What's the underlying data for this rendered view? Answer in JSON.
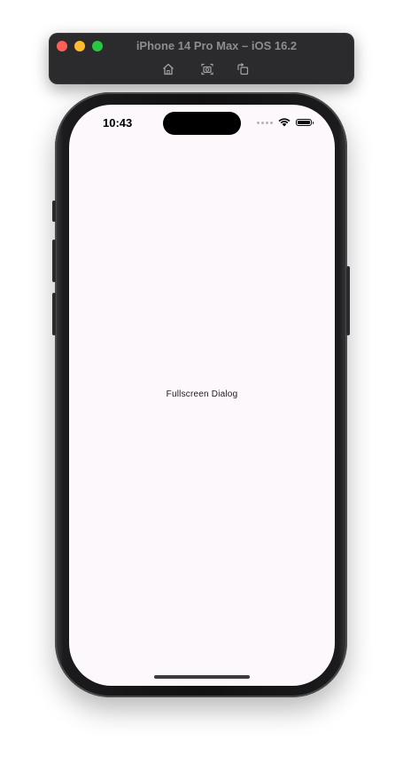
{
  "simulator": {
    "title": "iPhone 14 Pro Max – iOS 16.2",
    "tools": [
      {
        "icon": "home-icon",
        "label": "Home"
      },
      {
        "icon": "screenshot-icon",
        "label": "Screenshot"
      },
      {
        "icon": "rotate-icon",
        "label": "Rotate"
      }
    ],
    "window_controls": [
      "close",
      "minimize",
      "zoom"
    ]
  },
  "status_bar": {
    "time": "10:43",
    "icons": [
      "cellular-signal-icon",
      "wifi-icon",
      "battery-icon"
    ]
  },
  "screen": {
    "background": "#fdf8fc",
    "dialog_text": "Fullscreen Dialog"
  }
}
